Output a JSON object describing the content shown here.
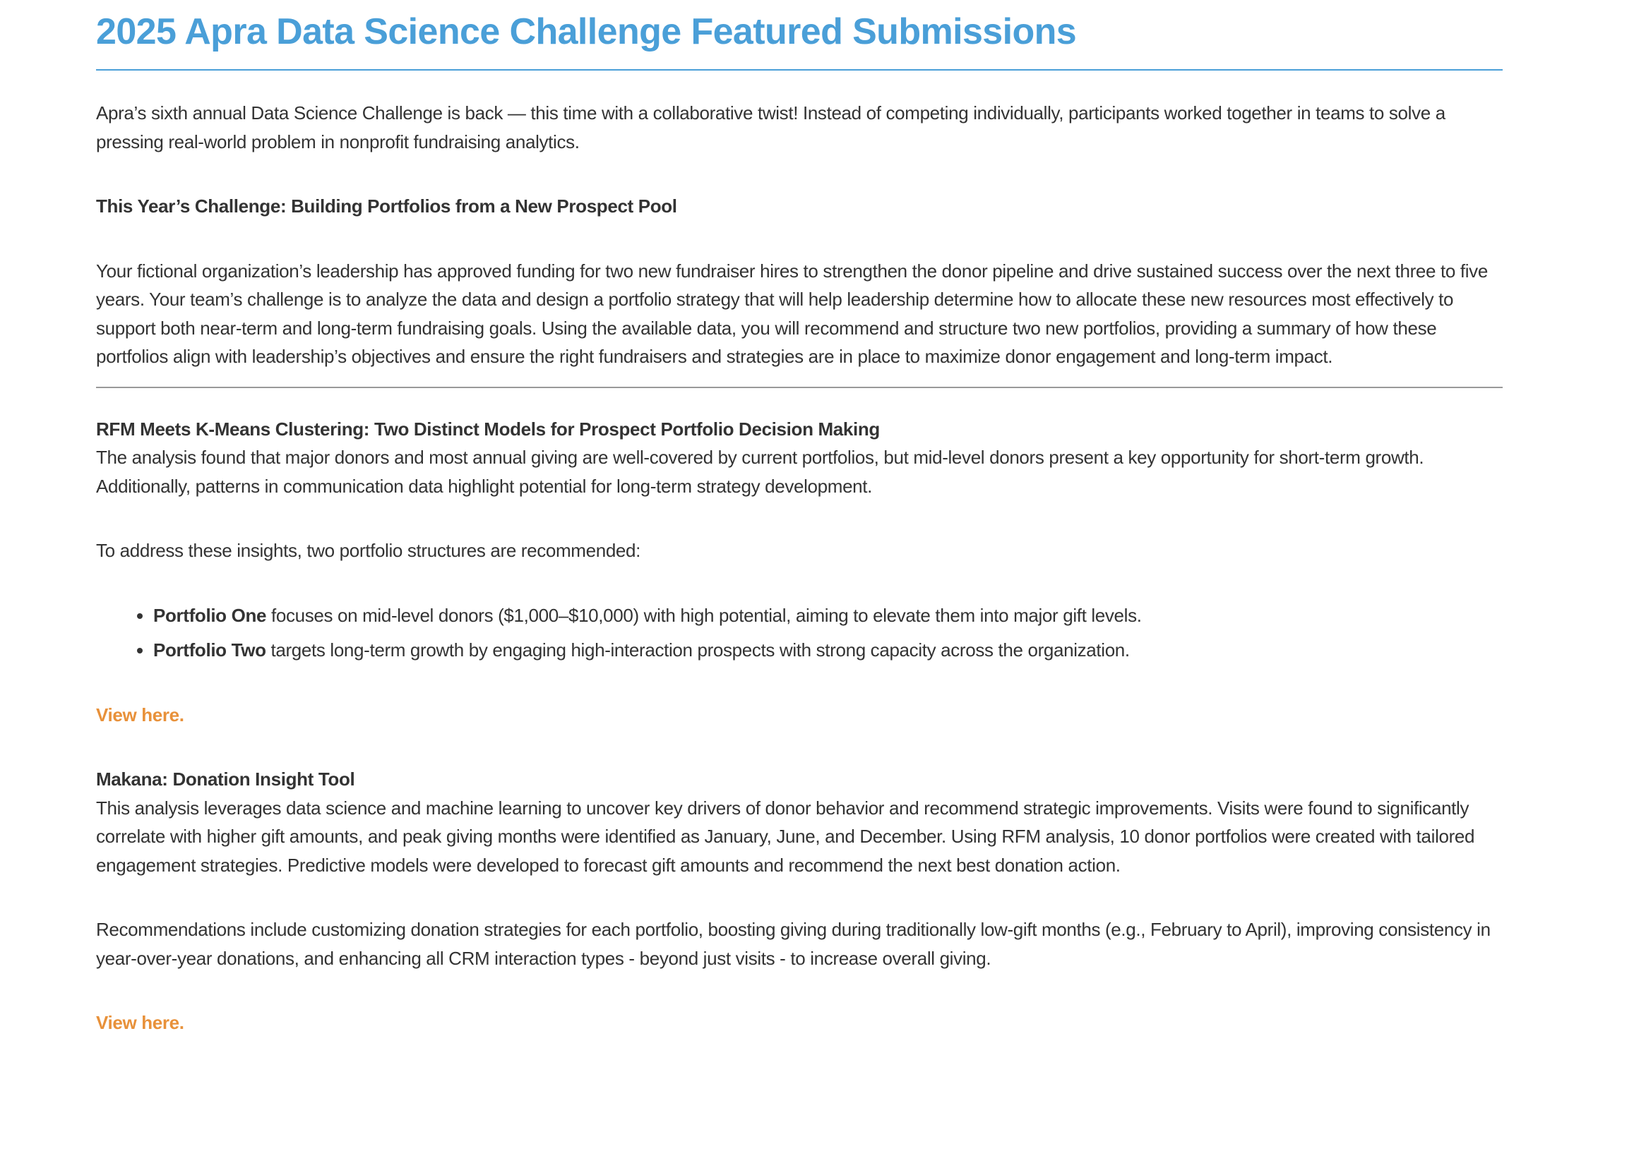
{
  "title": "2025 Apra Data Science Challenge Featured Submissions",
  "intro": "Apra’s sixth annual Data Science Challenge is back — this time with a collaborative twist! Instead of competing individually, participants worked together in teams to solve a pressing real-world problem in nonprofit fundraising analytics.",
  "challenge": {
    "heading": "This Year’s Challenge: Building Portfolios from a New Prospect Pool",
    "body": "Your fictional organization’s leadership has approved funding for two new fundraiser hires to strengthen the donor pipeline and drive sustained success over the next three to five years. Your team’s challenge is to analyze the data and design a portfolio strategy that will help leadership determine how to allocate these new resources most effectively to support both near-term and long-term fundraising goals. Using the available data, you will recommend and structure two new portfolios, providing a summary of how these portfolios align with leadership’s objectives and ensure the right fundraisers and strategies are in place to maximize donor engagement and long-term impact."
  },
  "submissions": [
    {
      "heading": "RFM Meets K-Means Clustering: Two Distinct Models for Prospect Portfolio Decision Making",
      "body": "The analysis found that major donors and most annual giving are well-covered by current portfolios, but mid-level donors present a key opportunity for short-term growth. Additionally, patterns in communication data highlight potential for long-term strategy development.",
      "body2": "To address these insights, two portfolio structures are recommended:",
      "bullets": [
        {
          "bold": "Portfolio One",
          "text": " focuses on mid-level donors ($1,000–$10,000) with high potential, aiming to elevate them into major gift levels."
        },
        {
          "bold": "Portfolio Two",
          "text": " targets long-term growth by engaging high-interaction prospects with strong capacity across the organization."
        }
      ],
      "link": "View here."
    },
    {
      "heading": "Makana: Donation Insight Tool",
      "body": "This analysis leverages data science and machine learning to uncover key drivers of donor behavior and recommend strategic improvements. Visits were found to significantly correlate with higher gift amounts, and peak giving months were identified as January, June, and December. Using RFM analysis, 10 donor portfolios were created with tailored engagement strategies. Predictive models were developed to forecast gift amounts and recommend the next best donation action.",
      "body2": "Recommendations include customizing donation strategies for each portfolio, boosting giving during traditionally low-gift months (e.g., February to April), improving consistency in year-over-year donations, and enhancing all CRM interaction types - beyond just visits - to increase overall giving.",
      "link": "View here."
    }
  ],
  "colors": {
    "title": "#4a9fd8",
    "link": "#e8913a",
    "text": "#333333"
  }
}
